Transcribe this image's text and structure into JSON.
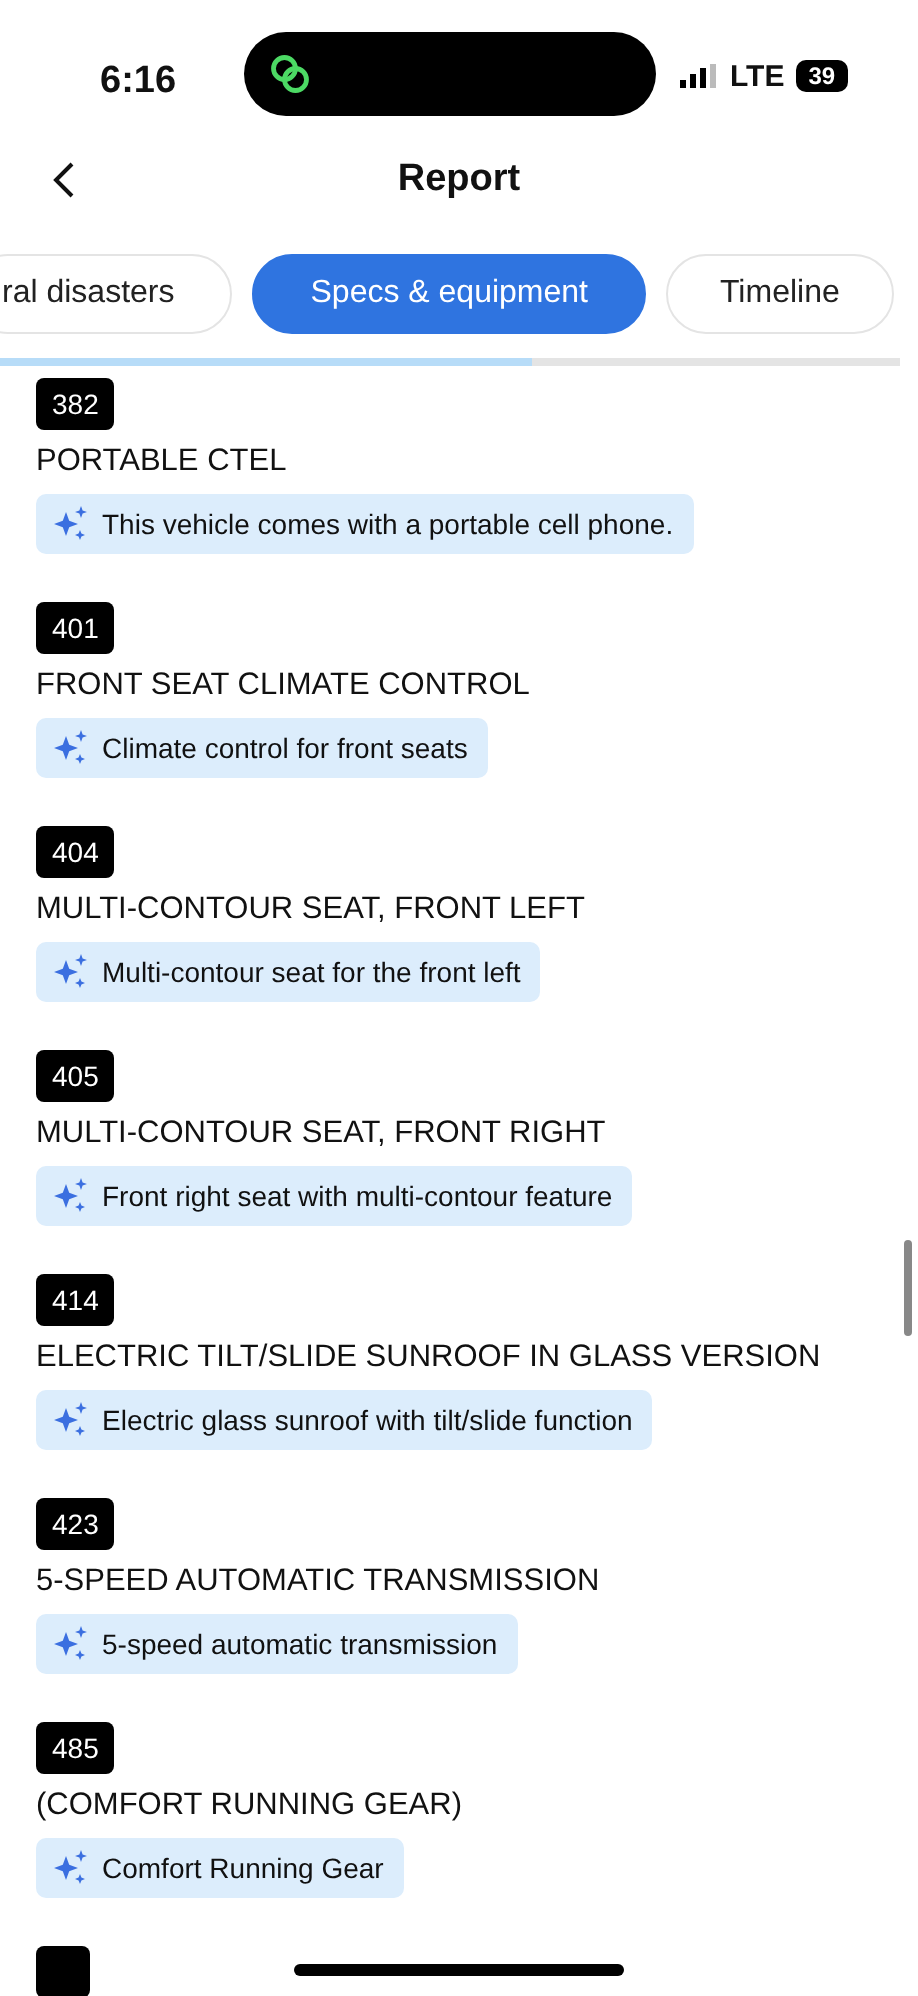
{
  "status_bar": {
    "time": "6:16",
    "network": "LTE",
    "battery": "39"
  },
  "nav": {
    "title": "Report"
  },
  "tabs": [
    {
      "label": "ral disasters",
      "selected": false
    },
    {
      "label": "Specs & equipment",
      "selected": true
    },
    {
      "label": "Timeline",
      "selected": false
    }
  ],
  "tab_progress": {
    "level": 0.59
  },
  "items": [
    {
      "code": "382",
      "title": "PORTABLE CTEL",
      "summary": "This vehicle comes with a portable cell phone."
    },
    {
      "code": "401",
      "title": "FRONT SEAT CLIMATE CONTROL",
      "summary": "Climate control for front seats"
    },
    {
      "code": "404",
      "title": "MULTI-CONTOUR SEAT, FRONT LEFT",
      "summary": "Multi-contour seat for the front left"
    },
    {
      "code": "405",
      "title": "MULTI-CONTOUR SEAT, FRONT RIGHT",
      "summary": "Front right seat with multi-contour feature"
    },
    {
      "code": "414",
      "title": "ELECTRIC TILT/SLIDE SUNROOF IN GLASS VERSION",
      "summary": "Electric glass sunroof with tilt/slide function"
    },
    {
      "code": "423",
      "title": "5-SPEED AUTOMATIC TRANSMISSION",
      "summary": "5-speed automatic transmission"
    },
    {
      "code": "485",
      "title": "(COMFORT RUNNING GEAR)",
      "summary": "Comfort Running Gear"
    }
  ]
}
